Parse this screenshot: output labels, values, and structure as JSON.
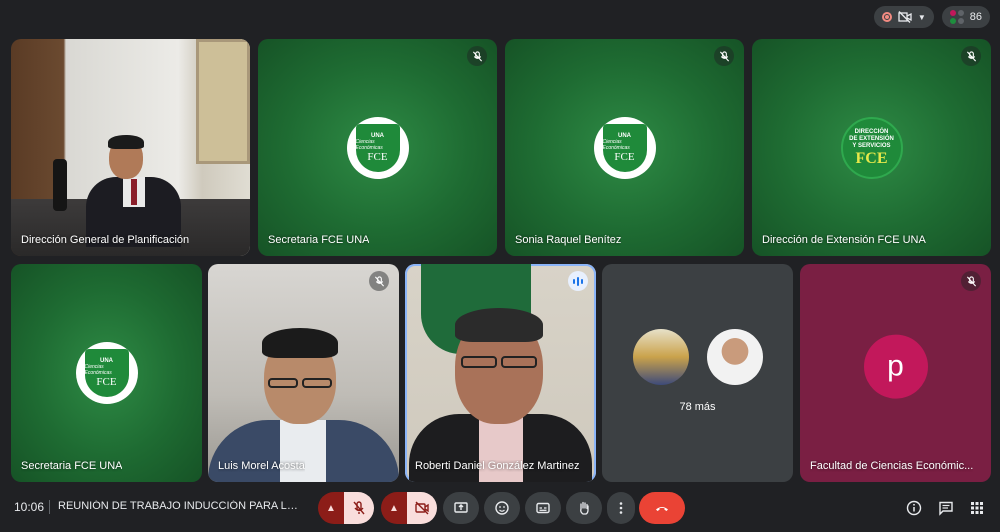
{
  "topbar": {
    "participant_count": "86"
  },
  "tiles": {
    "planificacion": {
      "name": "Dirección General de Planificación"
    },
    "secretaria1": {
      "name": "Secretaria FCE UNA"
    },
    "sonia": {
      "name": "Sonia Raquel Benítez"
    },
    "extension": {
      "name": "Dirección de Extensión FCE UNA"
    },
    "secretaria2": {
      "name": "Secretaria FCE UNA"
    },
    "luis": {
      "name": "Luis Morel Acosta"
    },
    "roberti": {
      "name": "Roberti Daniel González Martinez"
    },
    "others": {
      "more_label": "78 más"
    },
    "facultad": {
      "name": "Facultad de Ciencias Económic...",
      "avatar_letter": "p"
    }
  },
  "logos": {
    "fce": {
      "top": "UNA",
      "middle": "Ciencias Económicas",
      "bottom": "FCE"
    },
    "extension": {
      "line1": "DIRECCIÓN",
      "line2": "DE EXTENSIÓN",
      "line3": "Y SERVICIOS",
      "mark": "FCE"
    }
  },
  "bottombar": {
    "time": "10:06",
    "meeting_title": "REUNIÓN DE TRABAJO INDUCCIÓN PARA LA F..."
  },
  "colors": {
    "background": "#202124",
    "tile_green": "#1e6b32",
    "tile_gray": "#3c4043",
    "tile_magenta": "#7a1f43",
    "end_call": "#ea4335",
    "speaking_border": "#8ab4f8"
  },
  "icons": [
    "record-icon",
    "camera-off-icon",
    "participants-icon",
    "mic-off-icon",
    "chevron-up-icon",
    "present-icon",
    "emoji-icon",
    "captions-icon",
    "raise-hand-icon",
    "more-options-icon",
    "end-call-icon",
    "info-icon",
    "chat-icon",
    "apps-icon"
  ]
}
